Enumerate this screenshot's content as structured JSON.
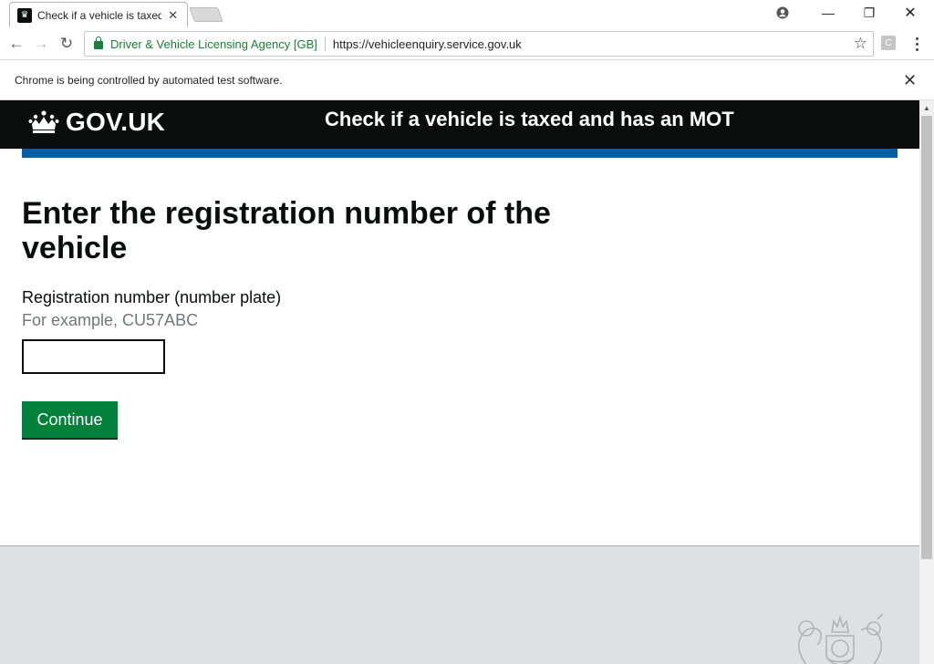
{
  "browser": {
    "tab_title": "Check if a vehicle is taxed",
    "tab_close": "✕",
    "window": {
      "user_icon": "account-circle-icon",
      "minimize": "—",
      "restore": "❐",
      "close": "✕"
    },
    "site_org": "Driver & Vehicle Licensing Agency [GB]",
    "url": "https://vehicleenquiry.service.gov.uk",
    "extension_label": "C",
    "infobar_text": "Chrome is being controlled by automated test software.",
    "infobar_close": "✕"
  },
  "header": {
    "logotype": "GOV.UK",
    "service_name": "Check if a vehicle is taxed and has an MOT"
  },
  "main": {
    "heading": "Enter the registration number of the vehicle",
    "field_label": "Registration number (number plate)",
    "field_hint": "For example, CU57ABC",
    "input_value": "",
    "continue_label": "Continue"
  },
  "colors": {
    "header_bg": "#0b0c0c",
    "header_stripe": "#005ea5",
    "button_green": "#00823b",
    "hint_grey": "#6f777b",
    "footer_bg": "#dee0e2"
  }
}
